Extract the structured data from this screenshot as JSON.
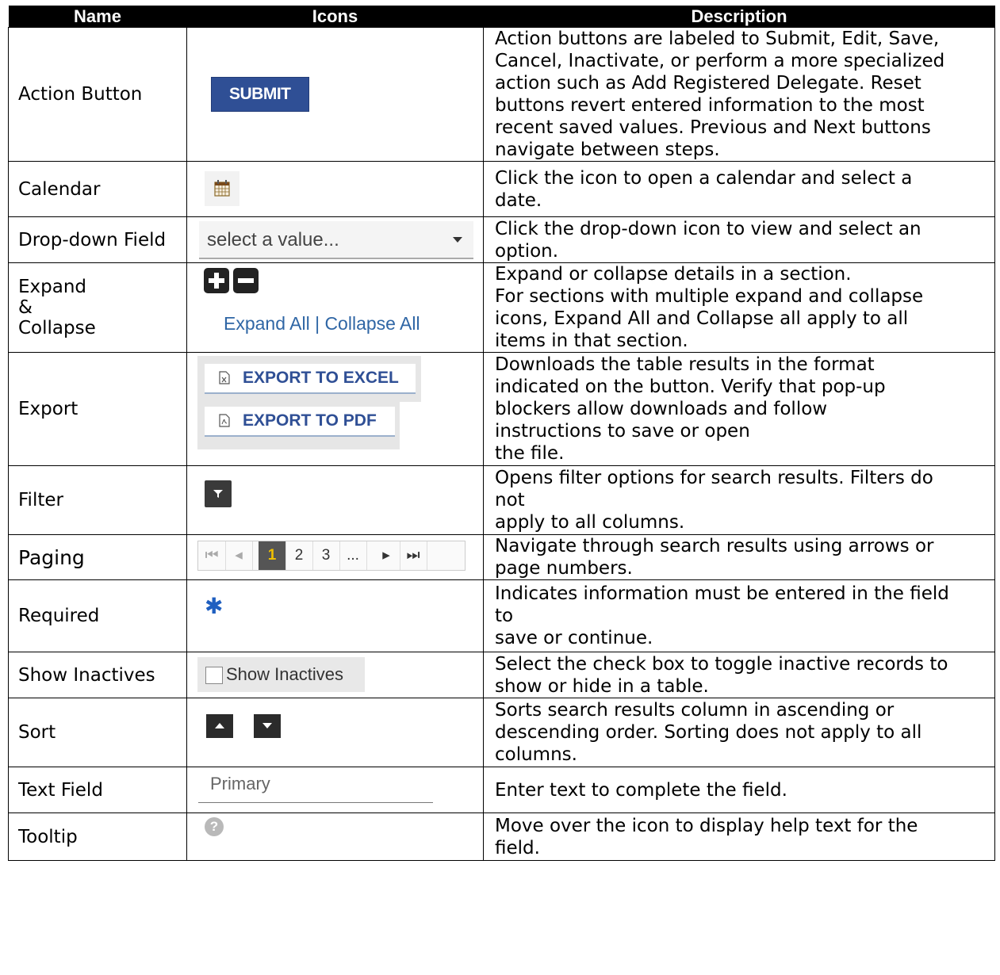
{
  "headers": {
    "name": "Name",
    "icons": "Icons",
    "description": "Description"
  },
  "rows": {
    "action": {
      "name": "Action Button",
      "button": "SUBMIT",
      "desc": [
        "Action buttons are labeled to Submit, Edit, Save,",
        "Cancel, Inactivate, or perform a more specialized",
        "action such as Add Registered Delegate. Reset",
        "buttons revert entered information to the most",
        "recent saved values. Previous and Next buttons",
        "navigate between steps."
      ]
    },
    "calendar": {
      "name": "Calendar",
      "icon": "calendar-icon",
      "desc": [
        "Click the icon to open a calendar and select a",
        "date."
      ]
    },
    "dropdown": {
      "name": "Drop-down Field",
      "value": "select a value...",
      "desc": [
        "Click the drop-down icon to view and select an",
        "option."
      ]
    },
    "expand": {
      "name": [
        "Expand",
        "&",
        "Collapse"
      ],
      "links": "Expand All | Collapse All",
      "desc": [
        "Expand or collapse details in a section.",
        "For sections with multiple expand and collapse",
        "icons, Expand All and Collapse all apply to all",
        "items in that section."
      ]
    },
    "export": {
      "name": "Export",
      "excel": "EXPORT TO EXCEL",
      "pdf": "EXPORT TO PDF",
      "desc": [
        "Downloads the table results in the format",
        "indicated on the button. Verify that pop-up",
        "blockers allow downloads and follow",
        "instructions to save or open",
        "the file."
      ]
    },
    "filter": {
      "name": "Filter",
      "icon": "filter-icon",
      "desc": [
        "Opens filter options for search results. Filters do",
        "not",
        "apply to all columns."
      ]
    },
    "paging": {
      "name": "Paging",
      "pages": [
        "1",
        "2",
        "3",
        "..."
      ],
      "desc": [
        "Navigate through search results using arrows or",
        "page numbers."
      ]
    },
    "required": {
      "name": "Required",
      "icon": "asterisk-icon",
      "glyph": "✱",
      "desc": [
        "Indicates information must be entered in the field",
        "to",
        "save or continue."
      ]
    },
    "inactives": {
      "name": "Show Inactives",
      "label": "Show Inactives",
      "desc": [
        "Select the check box to toggle inactive records to",
        "show or hide in a table."
      ]
    },
    "sort": {
      "name": "Sort",
      "desc": [
        "Sorts search results column in ascending or",
        "descending order. Sorting does not apply to all",
        "columns."
      ]
    },
    "text": {
      "name": "Text Field",
      "value": "Primary",
      "desc": [
        "Enter text to complete the field."
      ]
    },
    "tooltip": {
      "name": "Tooltip",
      "glyph": "?",
      "desc": [
        "Move over the icon to display help text for the",
        "field."
      ]
    }
  },
  "colors": {
    "header_bg": "#000000",
    "button_blue": "#2f4f95",
    "link_blue": "#2f66a5",
    "page_active": "#f0c000"
  }
}
